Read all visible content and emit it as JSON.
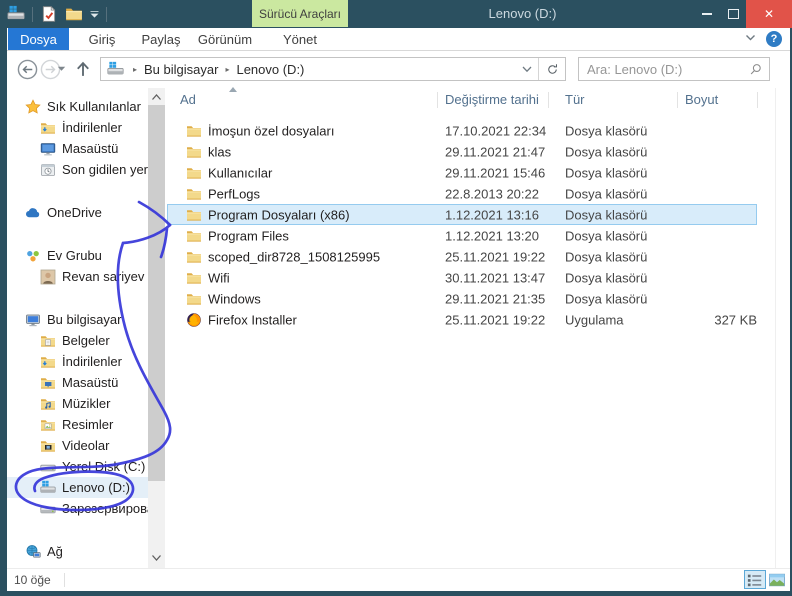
{
  "titlebar": {
    "title": "Lenovo (D:)",
    "contextual_group": "Sürücü Araçları",
    "quick_access_icons": [
      "explorer-app-icon",
      "properties-icon",
      "new-folder-icon",
      "chevron-down-icon"
    ]
  },
  "ribbon": {
    "tabs": [
      {
        "label": "Dosya",
        "active": true
      },
      {
        "label": "Giriş",
        "active": false
      },
      {
        "label": "Paylaş",
        "active": false
      },
      {
        "label": "Görünüm",
        "active": false
      },
      {
        "label": "Yönet",
        "active": false,
        "contextual": true
      }
    ],
    "help_label": "?"
  },
  "addressbar": {
    "crumbs": [
      "Bu bilgisayar",
      "Lenovo (D:)"
    ],
    "location_icon": "drive-windows"
  },
  "search": {
    "placeholder": "Ara: Lenovo (D:)"
  },
  "sidebar": {
    "items": [
      {
        "label": "Sık Kullanılanlar",
        "icon": "star",
        "indent": 0,
        "section_start": false,
        "selected": false
      },
      {
        "label": "İndirilenler",
        "icon": "folder-down",
        "indent": 1,
        "section_start": false,
        "selected": false
      },
      {
        "label": "Masaüstü",
        "icon": "monitor",
        "indent": 1,
        "section_start": false,
        "selected": false
      },
      {
        "label": "Son gidilen yerler",
        "icon": "recent",
        "indent": 1,
        "section_start": false,
        "selected": false
      },
      {
        "label": "OneDrive",
        "icon": "cloud",
        "indent": 0,
        "section_start": true,
        "selected": false
      },
      {
        "label": "Ev Grubu",
        "icon": "homegroup",
        "indent": 0,
        "section_start": true,
        "selected": false
      },
      {
        "label": "Revan sariyev",
        "icon": "user",
        "indent": 1,
        "section_start": false,
        "selected": false
      },
      {
        "label": "Bu bilgisayar",
        "icon": "computer",
        "indent": 0,
        "section_start": true,
        "selected": false
      },
      {
        "label": "Belgeler",
        "icon": "folder-docs",
        "indent": 1,
        "section_start": false,
        "selected": false
      },
      {
        "label": "İndirilenler",
        "icon": "folder-down",
        "indent": 1,
        "section_start": false,
        "selected": false
      },
      {
        "label": "Masaüstü",
        "icon": "folder-desktop",
        "indent": 1,
        "section_start": false,
        "selected": false
      },
      {
        "label": "Müzikler",
        "icon": "folder-music",
        "indent": 1,
        "section_start": false,
        "selected": false
      },
      {
        "label": "Resimler",
        "icon": "folder-pic",
        "indent": 1,
        "section_start": false,
        "selected": false
      },
      {
        "label": "Videolar",
        "icon": "folder-video",
        "indent": 1,
        "section_start": false,
        "selected": false
      },
      {
        "label": "Yerel Disk (C:)",
        "icon": "drive",
        "indent": 1,
        "section_start": false,
        "selected": false
      },
      {
        "label": "Lenovo (D:)",
        "icon": "drive-windows",
        "indent": 1,
        "section_start": false,
        "selected": true
      },
      {
        "label": "Зарезервирован",
        "icon": "drive",
        "indent": 1,
        "section_start": false,
        "selected": false
      },
      {
        "label": "Ağ",
        "icon": "network",
        "indent": 0,
        "section_start": true,
        "selected": false
      }
    ]
  },
  "files": {
    "columns": [
      "Ad",
      "Değiştirme tarihi",
      "Tür",
      "Boyut"
    ],
    "sort_column": "Ad",
    "sort_direction": "asc",
    "rows": [
      {
        "name": "İmoşun özel dosyaları",
        "date": "17.10.2021 22:34",
        "type": "Dosya klasörü",
        "size": "",
        "icon": "folder",
        "selected": false
      },
      {
        "name": "klas",
        "date": "29.11.2021 21:47",
        "type": "Dosya klasörü",
        "size": "",
        "icon": "folder",
        "selected": false
      },
      {
        "name": "Kullanıcılar",
        "date": "29.11.2021 15:46",
        "type": "Dosya klasörü",
        "size": "",
        "icon": "folder",
        "selected": false
      },
      {
        "name": "PerfLogs",
        "date": "22.8.2013 20:22",
        "type": "Dosya klasörü",
        "size": "",
        "icon": "folder",
        "selected": false
      },
      {
        "name": "Program Dosyaları (x86)",
        "date": "1.12.2021 13:16",
        "type": "Dosya klasörü",
        "size": "",
        "icon": "folder",
        "selected": true
      },
      {
        "name": "Program Files",
        "date": "1.12.2021 13:20",
        "type": "Dosya klasörü",
        "size": "",
        "icon": "folder",
        "selected": false
      },
      {
        "name": "scoped_dir8728_1508125995",
        "date": "25.11.2021 19:22",
        "type": "Dosya klasörü",
        "size": "",
        "icon": "folder",
        "selected": false
      },
      {
        "name": "Wifi",
        "date": "30.11.2021 13:47",
        "type": "Dosya klasörü",
        "size": "",
        "icon": "folder",
        "selected": false
      },
      {
        "name": "Windows",
        "date": "29.11.2021 21:35",
        "type": "Dosya klasörü",
        "size": "",
        "icon": "folder",
        "selected": false
      },
      {
        "name": "Firefox Installer",
        "date": "25.11.2021 19:22",
        "type": "Uygulama",
        "size": "327 KB",
        "icon": "firefox",
        "selected": false
      }
    ]
  },
  "statusbar": {
    "item_count": "10 öğe"
  },
  "colors": {
    "titlebar": "#2b5060",
    "active_file_tab": "#2577d4",
    "contextual_tab_bg": "#cbe8a0",
    "close_button": "#e15349",
    "selection_bg": "#d8ecfa",
    "selection_border": "#95cbef",
    "ink_annotation": "#3636d9"
  },
  "annotation": {
    "description": "hand-drawn blue ink: loop circled around Lenovo (D:) in sidebar, long tail up to an arrowhead pointing at the selected row Program Dosyaları (x86)"
  }
}
